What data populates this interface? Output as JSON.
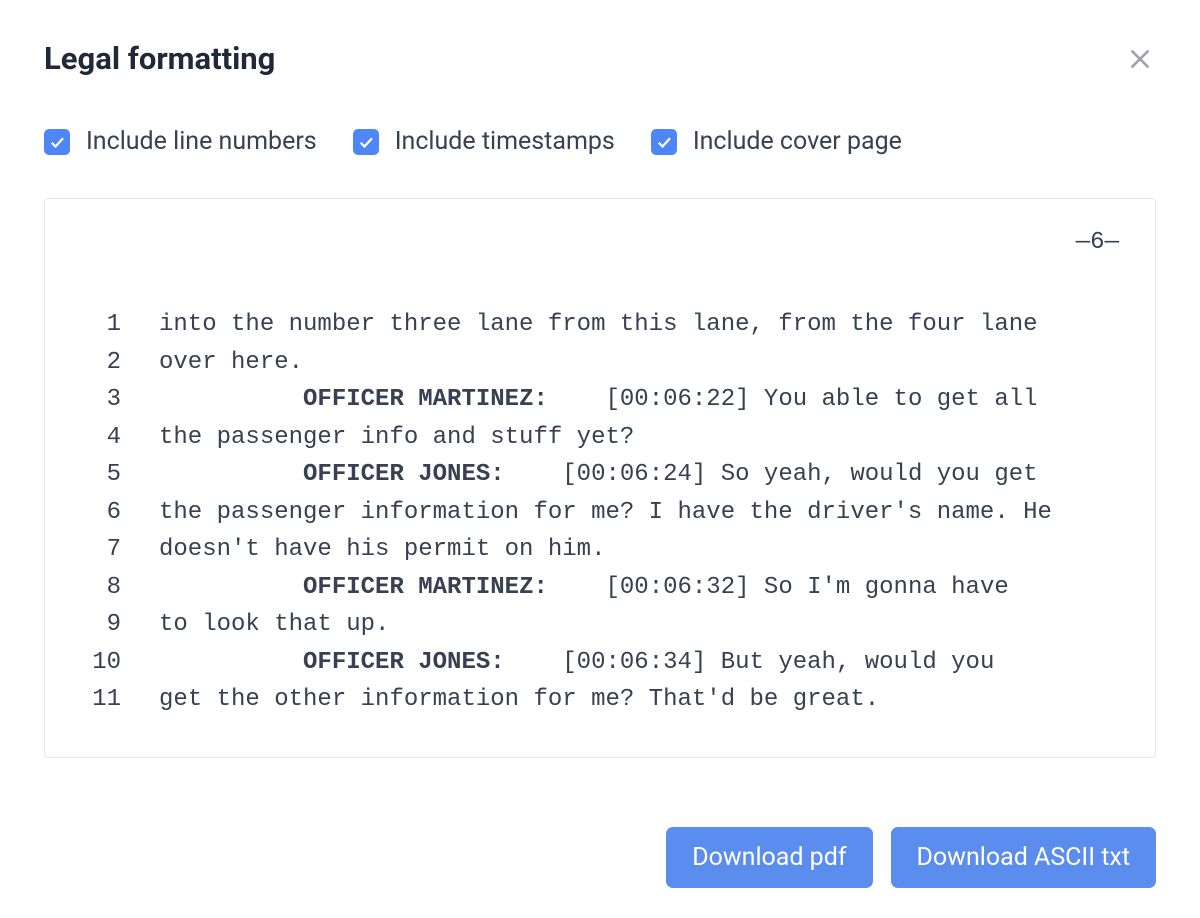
{
  "header": {
    "title": "Legal formatting"
  },
  "options": [
    {
      "label": "Include line numbers",
      "checked": true
    },
    {
      "label": "Include timestamps",
      "checked": true
    },
    {
      "label": "Include cover page",
      "checked": true
    }
  ],
  "transcript": {
    "page_marker": "—6—",
    "lines": [
      {
        "n": "1",
        "indent": "",
        "speaker": "",
        "ts": "",
        "text": "into the number three lane from this lane, from the four lane"
      },
      {
        "n": "2",
        "indent": "",
        "speaker": "",
        "ts": "",
        "text": "over here."
      },
      {
        "n": "3",
        "indent": "          ",
        "speaker": "OFFICER MARTINEZ:",
        "ts": "    [00:06:22] ",
        "text": "You able to get all"
      },
      {
        "n": "4",
        "indent": "",
        "speaker": "",
        "ts": "",
        "text": "the passenger info and stuff yet?"
      },
      {
        "n": "5",
        "indent": "          ",
        "speaker": "OFFICER JONES:",
        "ts": "    [00:06:24] ",
        "text": "So yeah, would you get"
      },
      {
        "n": "6",
        "indent": "",
        "speaker": "",
        "ts": "",
        "text": "the passenger information for me? I have the driver's name. He"
      },
      {
        "n": "7",
        "indent": "",
        "speaker": "",
        "ts": "",
        "text": "doesn't have his permit on him."
      },
      {
        "n": "8",
        "indent": "          ",
        "speaker": "OFFICER MARTINEZ:",
        "ts": "    [00:06:32] ",
        "text": "So I'm gonna have"
      },
      {
        "n": "9",
        "indent": "",
        "speaker": "",
        "ts": "",
        "text": "to look that up."
      },
      {
        "n": "10",
        "indent": "          ",
        "speaker": "OFFICER JONES:",
        "ts": "    [00:06:34] ",
        "text": "But yeah, would you"
      },
      {
        "n": "11",
        "indent": "",
        "speaker": "",
        "ts": "",
        "text": "get the other information for me? That'd be great."
      }
    ]
  },
  "buttons": {
    "download_pdf": "Download pdf",
    "download_txt": "Download ASCII txt"
  }
}
